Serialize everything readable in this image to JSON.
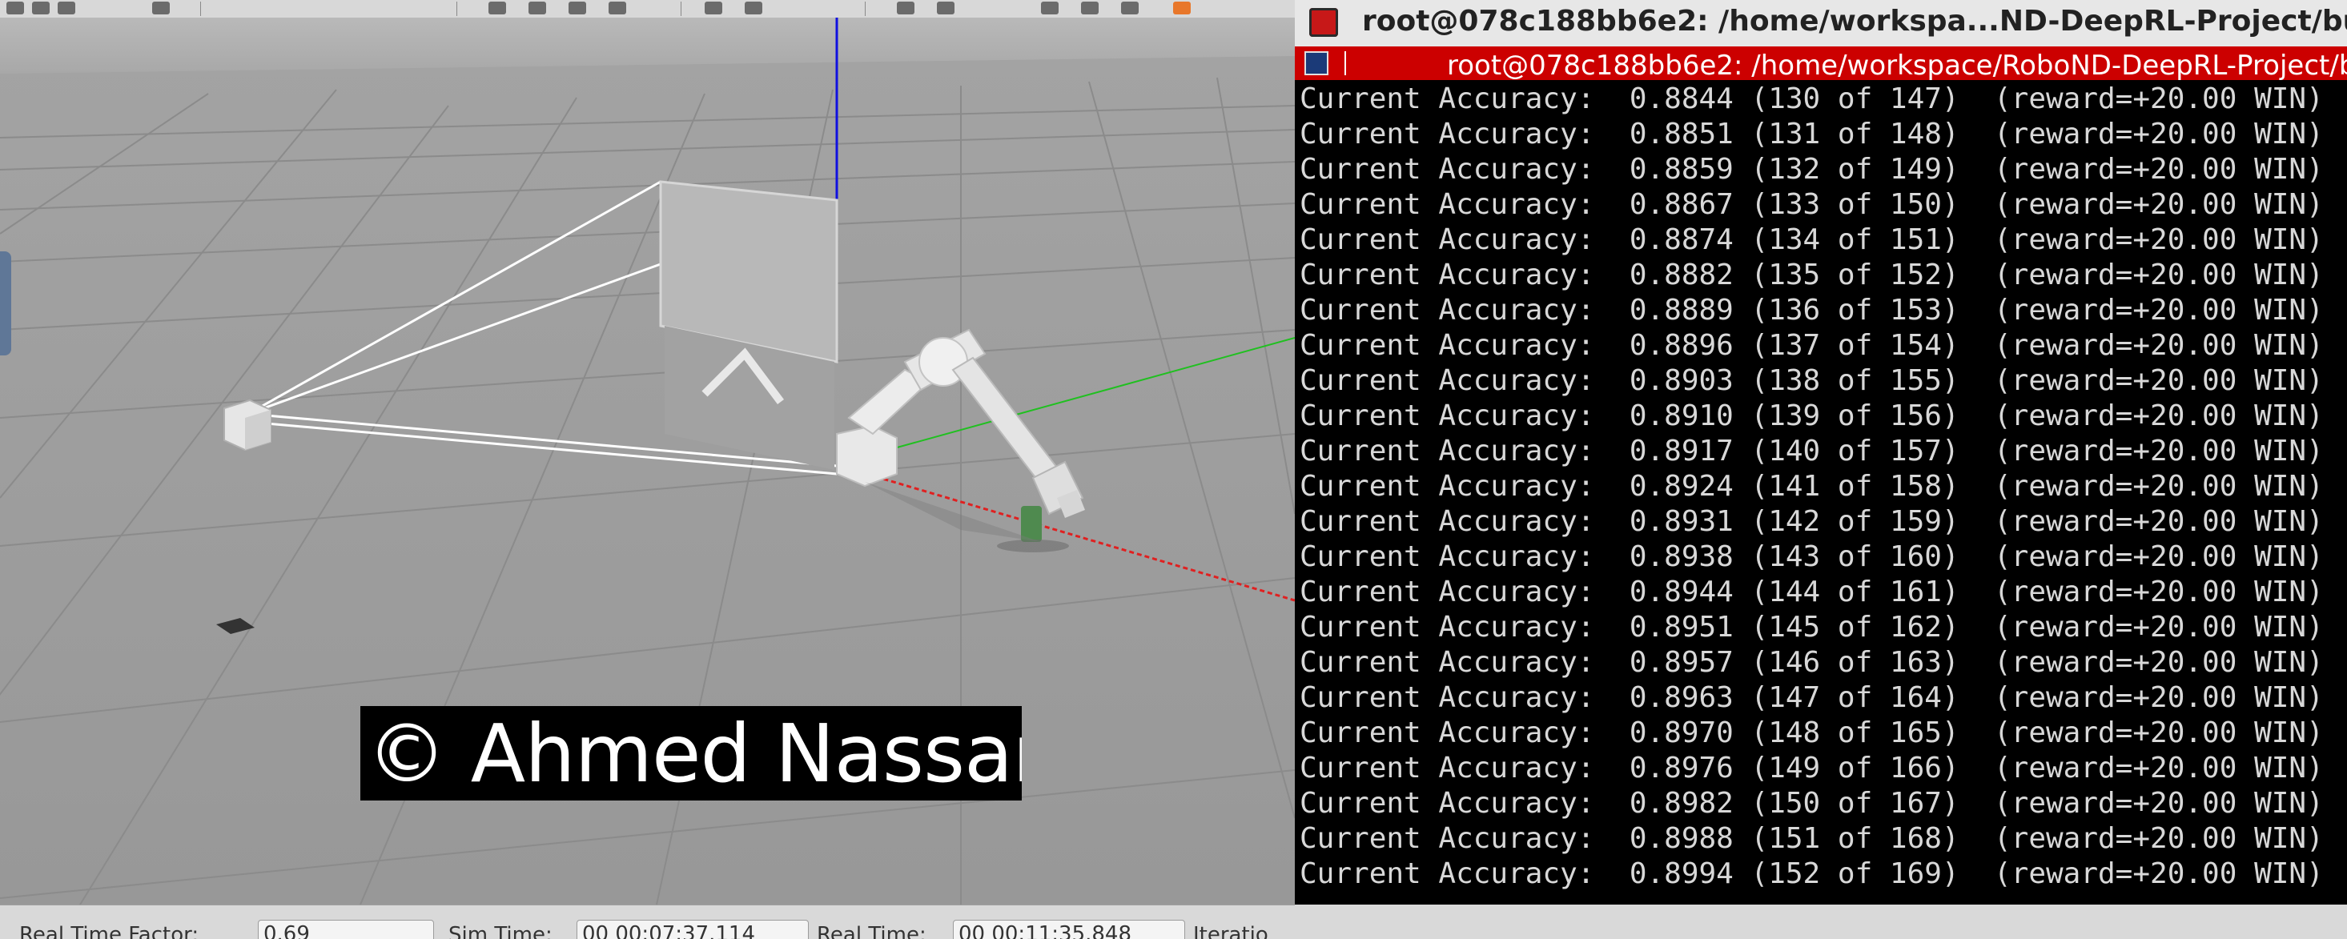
{
  "gazebo": {
    "watermark": "© Ahmed Nassar",
    "status": {
      "real_time_factor_label": "Real Time Factor:",
      "real_time_factor_value": "0.69",
      "sim_time_label": "Sim Time:",
      "sim_time_value": "00 00:07:37.114",
      "real_time_label": "Real Time:",
      "real_time_value": "00 00:11:35.848",
      "iterations_label": "Iteratio"
    }
  },
  "terminal": {
    "window_title": "root@078c188bb6e2: /home/workspa...ND-DeepRL-Project/bu",
    "tab_title": "root@078c188bb6e2: /home/workspace/RoboND-DeepRL-Project/b",
    "label": "Current Accuracy:",
    "lines": [
      {
        "acc": "0.8844",
        "count": "(130 of 147)",
        "reward": "(reward=+20.00 WIN)"
      },
      {
        "acc": "0.8851",
        "count": "(131 of 148)",
        "reward": "(reward=+20.00 WIN)"
      },
      {
        "acc": "0.8859",
        "count": "(132 of 149)",
        "reward": "(reward=+20.00 WIN)"
      },
      {
        "acc": "0.8867",
        "count": "(133 of 150)",
        "reward": "(reward=+20.00 WIN)"
      },
      {
        "acc": "0.8874",
        "count": "(134 of 151)",
        "reward": "(reward=+20.00 WIN)"
      },
      {
        "acc": "0.8882",
        "count": "(135 of 152)",
        "reward": "(reward=+20.00 WIN)"
      },
      {
        "acc": "0.8889",
        "count": "(136 of 153)",
        "reward": "(reward=+20.00 WIN)"
      },
      {
        "acc": "0.8896",
        "count": "(137 of 154)",
        "reward": "(reward=+20.00 WIN)"
      },
      {
        "acc": "0.8903",
        "count": "(138 of 155)",
        "reward": "(reward=+20.00 WIN)"
      },
      {
        "acc": "0.8910",
        "count": "(139 of 156)",
        "reward": "(reward=+20.00 WIN)"
      },
      {
        "acc": "0.8917",
        "count": "(140 of 157)",
        "reward": "(reward=+20.00 WIN)"
      },
      {
        "acc": "0.8924",
        "count": "(141 of 158)",
        "reward": "(reward=+20.00 WIN)"
      },
      {
        "acc": "0.8931",
        "count": "(142 of 159)",
        "reward": "(reward=+20.00 WIN)"
      },
      {
        "acc": "0.8938",
        "count": "(143 of 160)",
        "reward": "(reward=+20.00 WIN)"
      },
      {
        "acc": "0.8944",
        "count": "(144 of 161)",
        "reward": "(reward=+20.00 WIN)"
      },
      {
        "acc": "0.8951",
        "count": "(145 of 162)",
        "reward": "(reward=+20.00 WIN)"
      },
      {
        "acc": "0.8957",
        "count": "(146 of 163)",
        "reward": "(reward=+20.00 WIN)"
      },
      {
        "acc": "0.8963",
        "count": "(147 of 164)",
        "reward": "(reward=+20.00 WIN)"
      },
      {
        "acc": "0.8970",
        "count": "(148 of 165)",
        "reward": "(reward=+20.00 WIN)"
      },
      {
        "acc": "0.8976",
        "count": "(149 of 166)",
        "reward": "(reward=+20.00 WIN)"
      },
      {
        "acc": "0.8982",
        "count": "(150 of 167)",
        "reward": "(reward=+20.00 WIN)"
      },
      {
        "acc": "0.8988",
        "count": "(151 of 168)",
        "reward": "(reward=+20.00 WIN)"
      },
      {
        "acc": "0.8994",
        "count": "(152 of 169)",
        "reward": "(reward=+20.00 WIN)"
      }
    ]
  },
  "colors": {
    "terminal_tab_red": "#cc0000",
    "terminal_text": "#d8d8d8",
    "gazebo_ground": "#9e9e9e",
    "axis_x": "#e02020",
    "axis_y": "#20c020",
    "axis_z": "#1010e0"
  }
}
